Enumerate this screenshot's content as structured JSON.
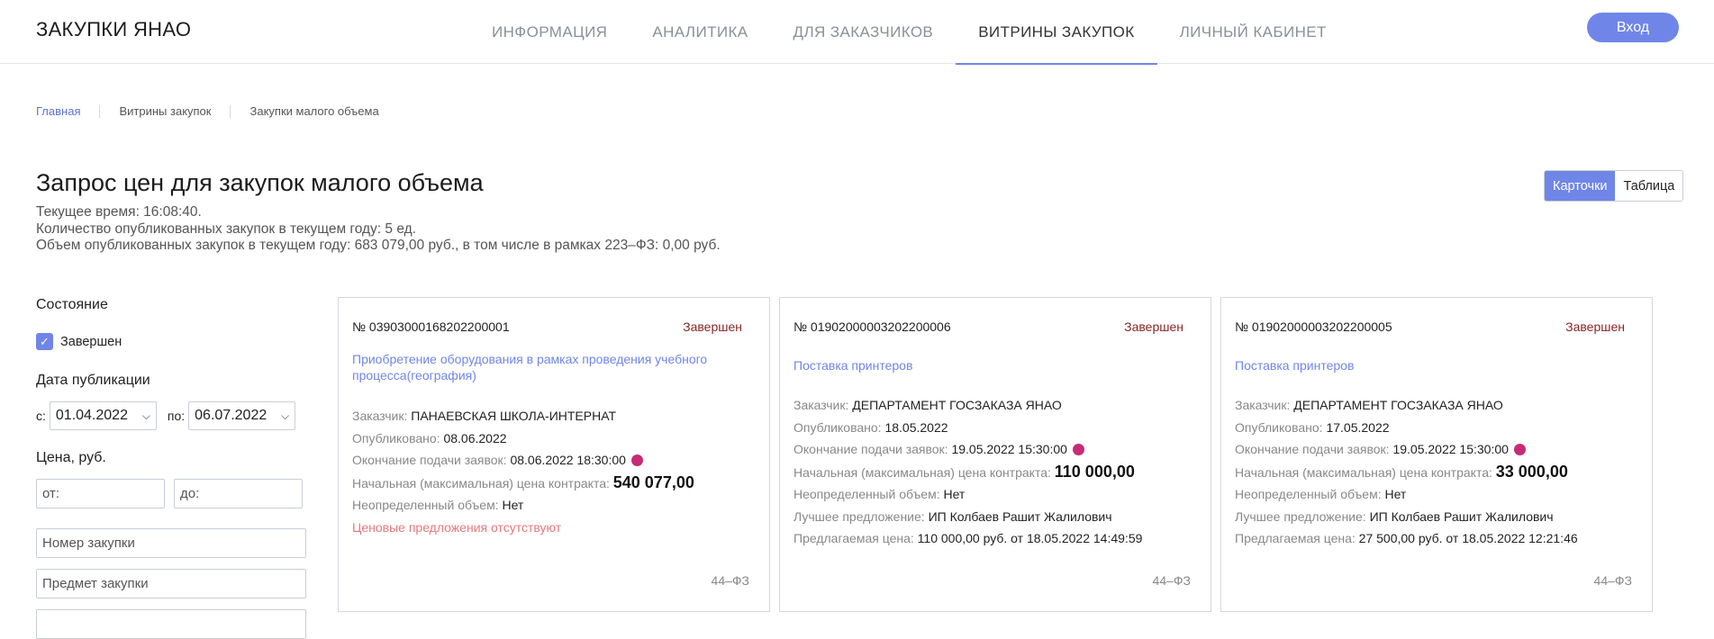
{
  "header": {
    "brand": "ЗАКУПКИ ЯНАО",
    "nav": [
      "ИНФОРМАЦИЯ",
      "АНАЛИТИКА",
      "ДЛЯ ЗАКАЗЧИКОВ",
      "ВИТРИНЫ ЗАКУПОК",
      "ЛИЧНЫЙ КАБИНЕТ"
    ],
    "active_nav": "ВИТРИНЫ ЗАКУПОК",
    "login_label": "Вход"
  },
  "breadcrumb": [
    "Главная",
    "Витрины закупок",
    "Закупки малого объема"
  ],
  "page": {
    "title": "Запрос цен для закупок малого объема",
    "current_time": "Текущее время: 16:08:40.",
    "count": "Количество опубликованных закупок в текущем году: 5 ед.",
    "volume": "Объем опубликованных закупок в текущем году: 683 079,00 руб., в том числе в рамках 223–ФЗ: 0,00 руб."
  },
  "view_toggle": {
    "cards": "Карточки",
    "table": "Таблица",
    "active": "Карточки"
  },
  "filters": {
    "state_label": "Состояние",
    "state_option": "Завершен",
    "date_label": "Дата публикации",
    "date_from_prefix": "с:",
    "date_from": "01.04.2022",
    "date_to_prefix": "по:",
    "date_to": "06.07.2022",
    "price_label": "Цена, руб.",
    "price_from_placeholder": "от:",
    "price_to_placeholder": "до:",
    "number_placeholder": "Номер закупки",
    "subject_placeholder": "Предмет закупки"
  },
  "labels": {
    "customer": "Заказчик:",
    "published": "Опубликовано:",
    "deadline": "Окончание подачи заявок:",
    "nmck": "Начальная (максимальная) цена контракта:",
    "undefined_volume": "Неопределенный объем:",
    "best_offer": "Лучшее предложение:",
    "offered_price": "Предлагаемая цена:"
  },
  "cards": [
    {
      "number": "№ 03903000168202200001",
      "status": "Завершен",
      "title": "Приобретение оборудования в рамках проведения учебного процесса(география)",
      "customer": "ПАНАЕВСКАЯ ШКОЛА-ИНТЕРНАТ",
      "published": "08.06.2022",
      "deadline": "08.06.2022 18:30:00",
      "price": "540 077,00",
      "undefined_volume": "Нет",
      "no_offers": "Ценовые предложения отсутствуют",
      "law": "44–ФЗ"
    },
    {
      "number": "№ 01902000003202200006",
      "status": "Завершен",
      "title": "Поставка принтеров",
      "customer": "ДЕПАРТАМЕНТ ГОСЗАКАЗА ЯНАО",
      "published": "18.05.2022",
      "deadline": "19.05.2022 15:30:00",
      "price": "110 000,00",
      "undefined_volume": "Нет",
      "best_offer": "ИП Колбаев Рашит Жалилович",
      "offered_price": "110 000,00 руб. от 18.05.2022 14:49:59",
      "law": "44–ФЗ"
    },
    {
      "number": "№ 01902000003202200005",
      "status": "Завершен",
      "title": "Поставка принтеров",
      "customer": "ДЕПАРТАМЕНТ ГОСЗАКАЗА ЯНАО",
      "published": "17.05.2022",
      "deadline": "19.05.2022 15:30:00",
      "price": "33 000,00",
      "undefined_volume": "Нет",
      "best_offer": "ИП Колбаев Рашит Жалилович",
      "offered_price": "27 500,00 руб. от 18.05.2022 12:21:46",
      "law": "44–ФЗ"
    }
  ],
  "colors": {
    "accent": "#6f86e8",
    "status": "#8a2424",
    "deadline_dot": "#c72a76",
    "no_offers": "#e6787c"
  }
}
